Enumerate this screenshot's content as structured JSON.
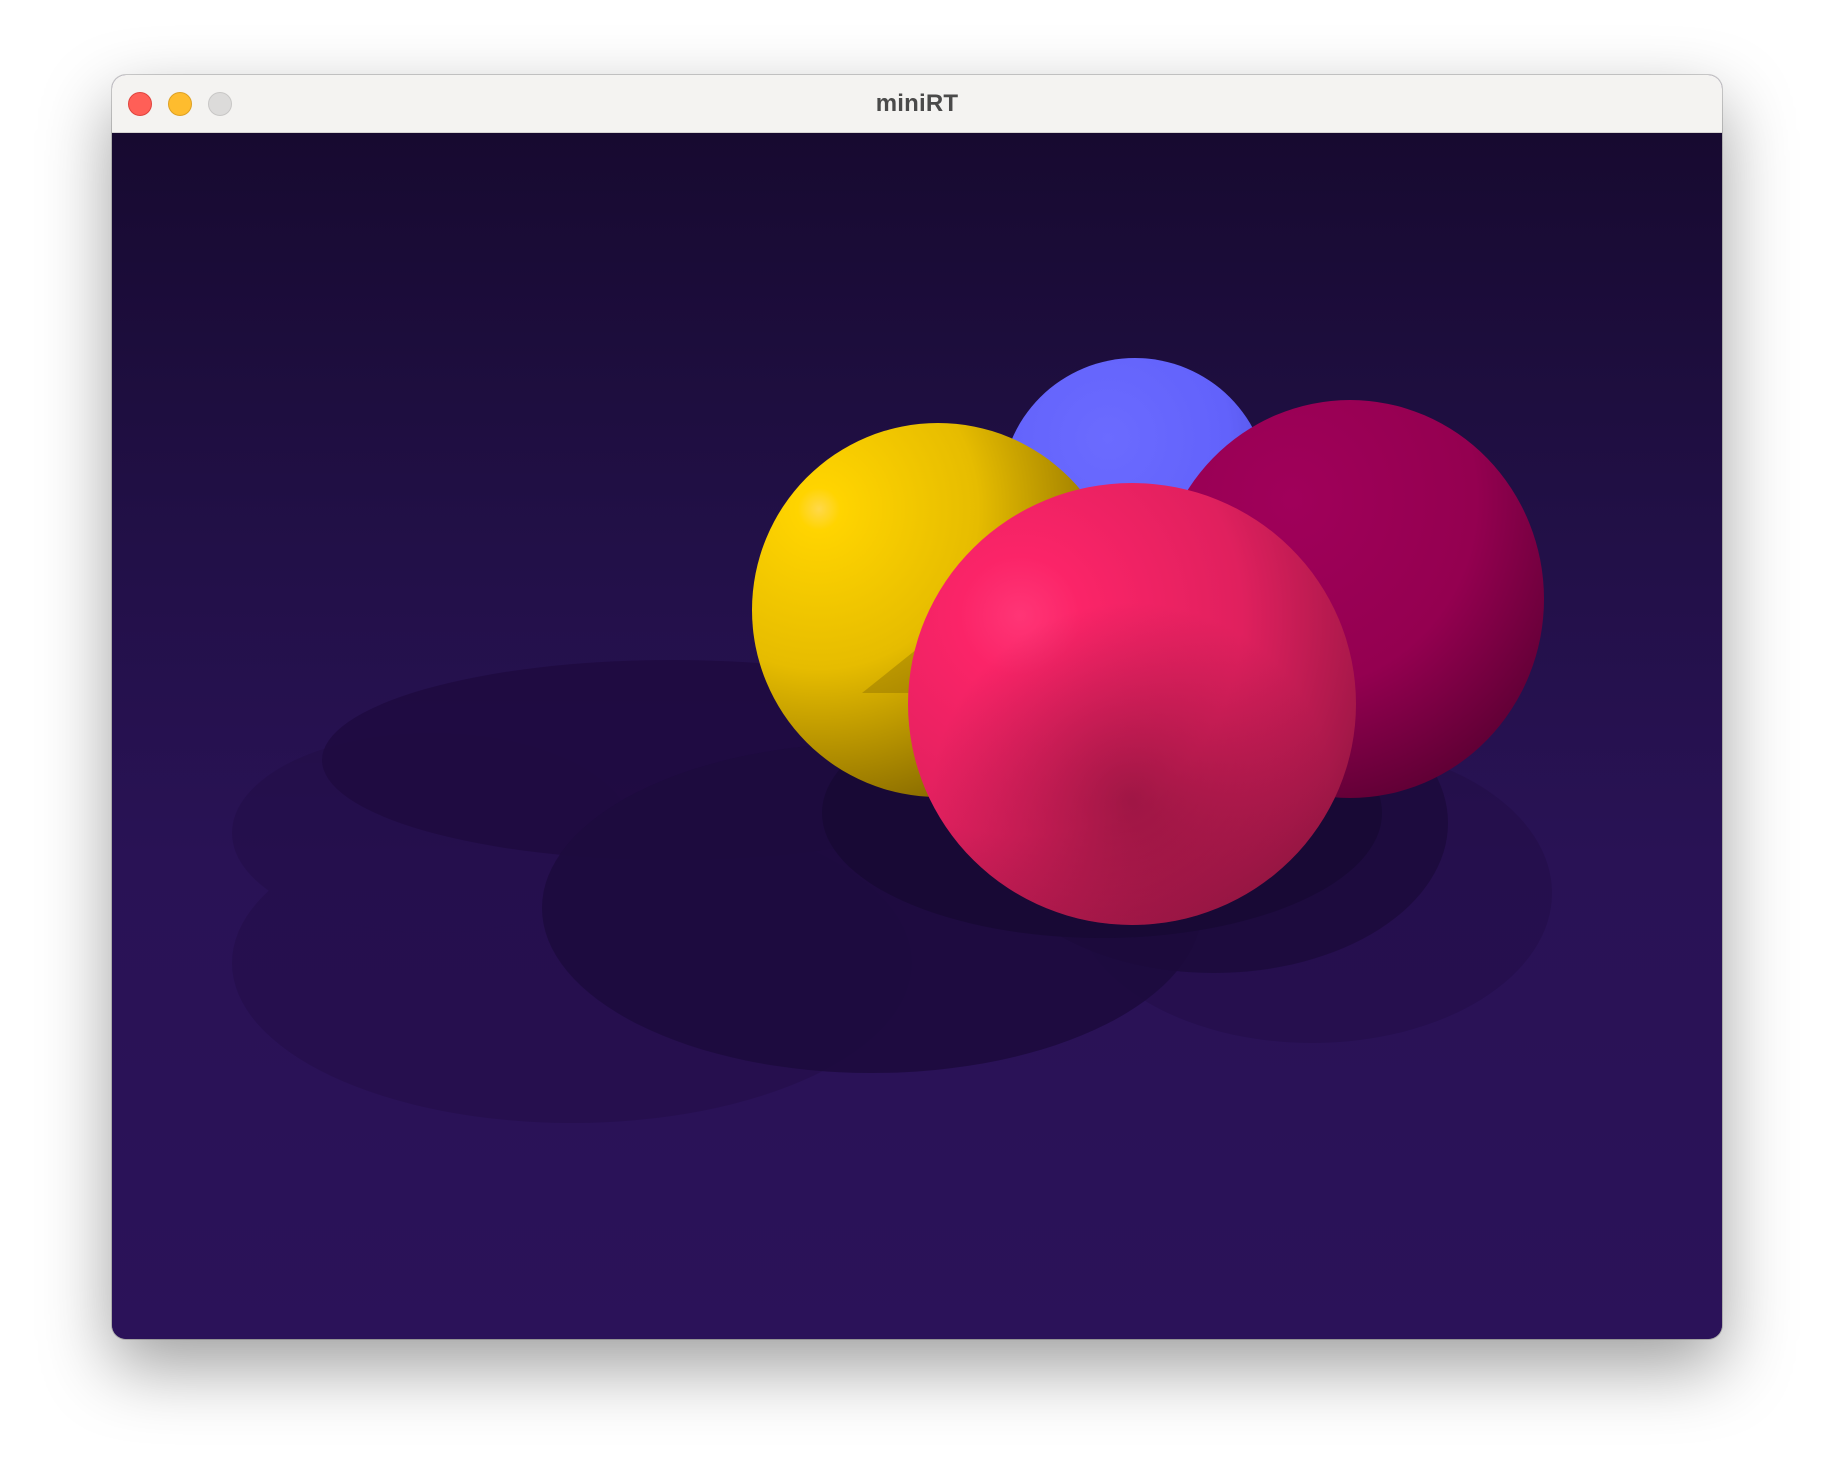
{
  "window": {
    "title": "miniRT",
    "buttons": {
      "close": "close-icon",
      "minimize": "minimize-icon",
      "zoom": "zoom-icon"
    }
  },
  "scene": {
    "background_top": "#160a2e",
    "background_bottom": "#2b1259",
    "spheres": [
      {
        "name": "blue",
        "color": "#6464ff"
      },
      {
        "name": "yellow",
        "color": "#ffd400"
      },
      {
        "name": "magenta",
        "color": "#9b0054"
      },
      {
        "name": "pink",
        "color": "#ff2468"
      }
    ]
  }
}
